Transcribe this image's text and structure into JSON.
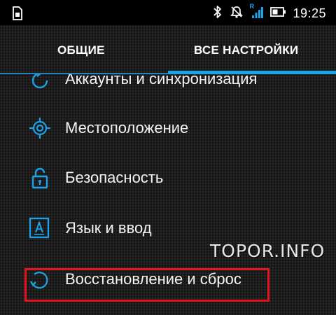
{
  "status_bar": {
    "time": "19:25",
    "signal_label": "R",
    "icons": [
      "sim-card-icon",
      "bluetooth-icon",
      "mute-icon",
      "signal-icon",
      "battery-icon"
    ]
  },
  "tabs": [
    {
      "label": "ОБЩИЕ",
      "selected": false
    },
    {
      "label": "ВСЕ НАСТРОЙКИ",
      "selected": true
    }
  ],
  "settings": {
    "items": [
      {
        "label": "Аккаунты и синхронизация",
        "icon": "sync-icon"
      },
      {
        "label": "Местоположение",
        "icon": "location-icon"
      },
      {
        "label": "Безопасность",
        "icon": "lock-icon"
      },
      {
        "label": "Язык и ввод",
        "icon": "language-icon"
      },
      {
        "label": "Восстановление и сброс",
        "icon": "reset-icon",
        "highlighted": true
      }
    ]
  },
  "watermark": "TOPOR.INFO",
  "colors": {
    "accent": "#1aa3e6",
    "highlight_border": "#e8101a",
    "background": "#1c1c1c"
  }
}
